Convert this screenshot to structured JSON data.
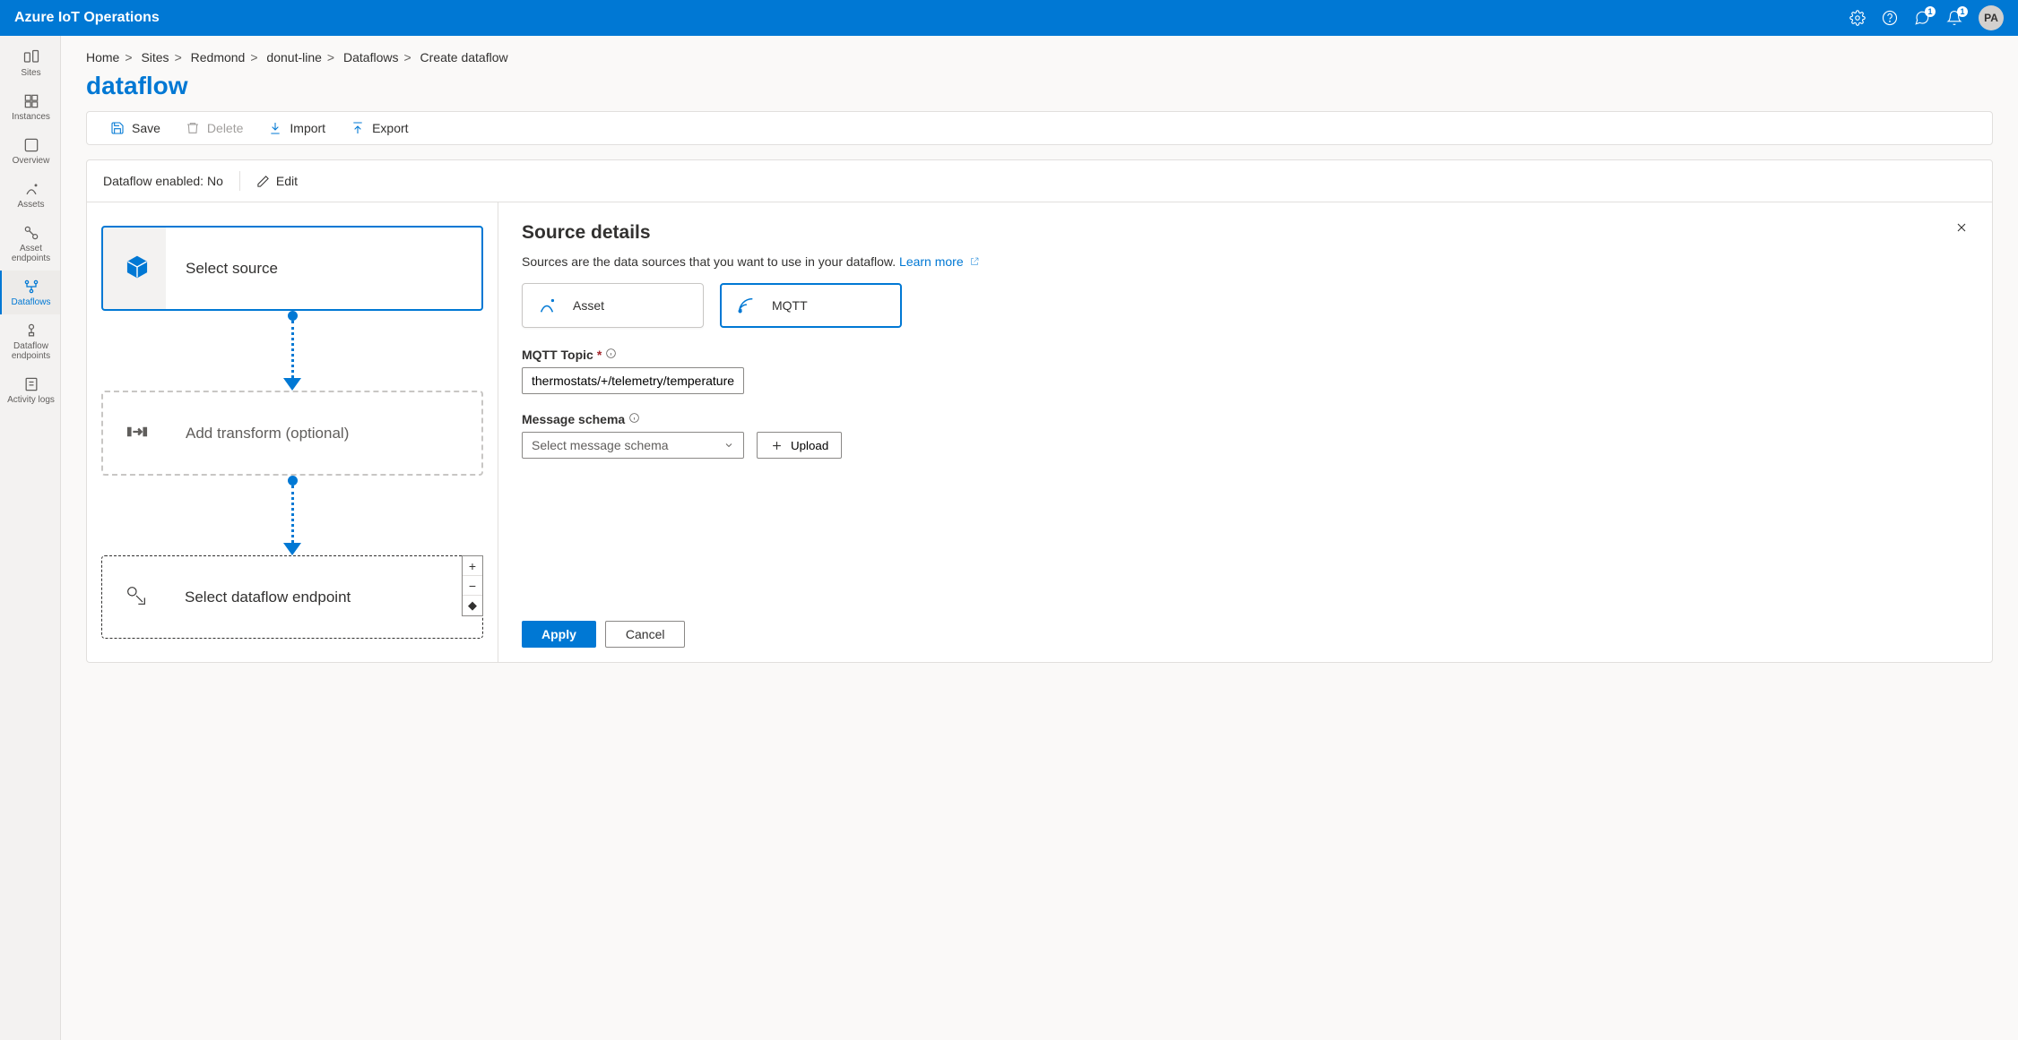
{
  "header": {
    "title": "Azure IoT Operations",
    "notifications_badge": "1",
    "feedback_badge": "1",
    "avatar": "PA"
  },
  "sidebar": {
    "items": [
      {
        "label": "Sites"
      },
      {
        "label": "Instances"
      },
      {
        "label": "Overview"
      },
      {
        "label": "Assets"
      },
      {
        "label": "Asset endpoints"
      },
      {
        "label": "Dataflows"
      },
      {
        "label": "Dataflow endpoints"
      },
      {
        "label": "Activity logs"
      }
    ]
  },
  "breadcrumb": {
    "items": [
      "Home",
      "Sites",
      "Redmond",
      "donut-line",
      "Dataflows",
      "Create dataflow"
    ]
  },
  "page": {
    "title": "dataflow"
  },
  "toolbar": {
    "save": "Save",
    "delete": "Delete",
    "import": "Import",
    "export": "Export"
  },
  "status": {
    "enabled_label": "Dataflow enabled: No",
    "edit": "Edit"
  },
  "flow": {
    "source": "Select source",
    "transform": "Add transform (optional)",
    "endpoint": "Select dataflow endpoint"
  },
  "details": {
    "title": "Source details",
    "description": "Sources are the data sources that you want to use in your dataflow.",
    "learn_more": "Learn more",
    "tiles": {
      "asset": "Asset",
      "mqtt": "MQTT"
    },
    "topic_label": "MQTT Topic",
    "topic_value": "thermostats/+/telemetry/temperature",
    "schema_label": "Message schema",
    "schema_placeholder": "Select message schema",
    "upload": "Upload",
    "apply": "Apply",
    "cancel": "Cancel"
  }
}
